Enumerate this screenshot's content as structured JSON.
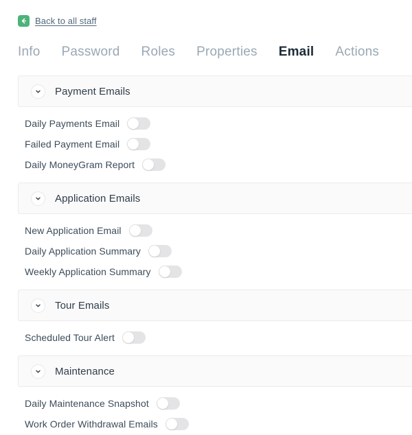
{
  "back": {
    "label": "Back to all staff",
    "icon": "arrow-left-icon",
    "icon_color": "#4cb37a"
  },
  "tabs": [
    {
      "label": "Info",
      "active": false
    },
    {
      "label": "Password",
      "active": false
    },
    {
      "label": "Roles",
      "active": false
    },
    {
      "label": "Properties",
      "active": false
    },
    {
      "label": "Email",
      "active": true
    },
    {
      "label": "Actions",
      "active": false
    }
  ],
  "colors": {
    "accent": "#4cb37a",
    "active_tab_text": "#1d2b36",
    "inactive_tab_text": "#9aa8b4",
    "label_text": "#3c4c5a",
    "section_bg": "#fafafa",
    "section_border": "#ebebeb",
    "toggle_off_track": "#e4e4e6",
    "toggle_knob": "#ffffff"
  },
  "sections": [
    {
      "title": "Payment Emails",
      "collapse_icon": "chevron-down-icon",
      "expanded": true,
      "rows": [
        {
          "label": "Daily Payments Email",
          "enabled": false
        },
        {
          "label": "Failed Payment Email",
          "enabled": false
        },
        {
          "label": "Daily MoneyGram Report",
          "enabled": false
        }
      ]
    },
    {
      "title": "Application Emails",
      "collapse_icon": "chevron-down-icon",
      "expanded": true,
      "rows": [
        {
          "label": "New Application Email",
          "enabled": false
        },
        {
          "label": "Daily Application Summary",
          "enabled": false
        },
        {
          "label": "Weekly Application Summary",
          "enabled": false
        }
      ]
    },
    {
      "title": "Tour Emails",
      "collapse_icon": "chevron-down-icon",
      "expanded": true,
      "rows": [
        {
          "label": "Scheduled Tour Alert",
          "enabled": false
        }
      ]
    },
    {
      "title": "Maintenance",
      "collapse_icon": "chevron-down-icon",
      "expanded": true,
      "rows": [
        {
          "label": "Daily Maintenance Snapshot",
          "enabled": false
        },
        {
          "label": "Work Order Withdrawal Emails",
          "enabled": false
        }
      ]
    }
  ]
}
